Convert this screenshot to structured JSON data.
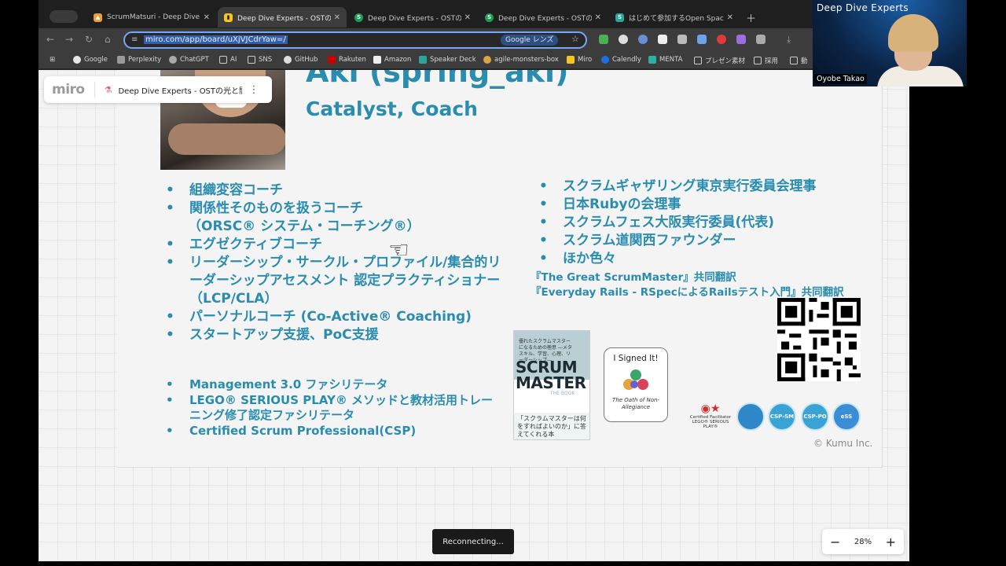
{
  "browser": {
    "tabs": [
      {
        "title": "ScrumMatsuri - Deep Dive Ex",
        "favicon_color": "#e8a040"
      },
      {
        "title": "Deep Dive Experts - OSTの光",
        "favicon_color": "#f5c61c",
        "active": true
      },
      {
        "title": "Deep Dive Experts - OSTの光",
        "favicon_color": "#1f9d55"
      },
      {
        "title": "Deep Dive Experts - OSTの光",
        "favicon_color": "#1f9d55"
      },
      {
        "title": "はじめて参加するOpen Space",
        "favicon_color": "#2aa59a"
      }
    ],
    "url": "miro.com/app/board/uXjVJCdrYaw=/",
    "lens_label": "Google レンズ",
    "bookmarks": [
      "Google",
      "Perplexity",
      "ChatGPT",
      "AI",
      "SNS",
      "GitHub",
      "Rakuten",
      "Amazon",
      "Speaker Deck",
      "agile-monsters-box",
      "Miro",
      "Calendly",
      "MENTA",
      "プレゼン素材",
      "採用",
      "動"
    ]
  },
  "miro": {
    "logo": "miro",
    "board_name": "Deep Dive Experts - OSTの光と闇 -",
    "zoom": "28%",
    "reconnect": "Reconnecting..."
  },
  "slide": {
    "name": "Aki (spring_aki)",
    "role": "Catalyst, Coach",
    "left_items": [
      "組織変容コーチ",
      "関係性そのものを扱うコーチ",
      "（ORSC® システム・コーチング®）",
      "エグゼクティブコーチ",
      "リーダーシップ・サークル・プロファイル/集合的リーダーシップアセスメント 認定プラクティショナー（LCP/CLA）",
      "パーソナルコーチ (Co-Active® Coaching)",
      "スタートアップ支援、PoC支援"
    ],
    "right_items": [
      "スクラムギャザリング東京実行委員会理事",
      "日本Rubyの会理事",
      "スクラムフェス大阪実行委員(代表)",
      "スクラム道関西ファウンダー",
      "ほか色々"
    ],
    "translations": [
      "『The Great ScrumMaster』共同翻訳",
      "『Everyday Rails - RSpecによるRailsテスト入門』共同翻訳"
    ],
    "cert_items": [
      "Management 3.0 ファシリテータ",
      "LEGO® SERIOUS PLAY® メソッドと教材活用トレーニング修了認定ファシリテータ",
      "Certified Scrum Professional(CSP)"
    ],
    "book": {
      "subtitle": "優れたスクラムマスターになるための極意 ―メタスキル、学習、心理、リーダーシップ―",
      "title1": "SCRUM",
      "title2": "MASTER",
      "title3": "THE BOOK",
      "tagline": "「スクラムマスターは何をすればよいのか」に答えてくれる本"
    },
    "signed": {
      "title": "I Signed It!",
      "subtitle": "The Oath of Non-Allegiance"
    },
    "badges": [
      "CSP-SM",
      "CSP-PO",
      "eSS"
    ],
    "facilitator": "Certified Facilitator LEGO® SERIOUS PLAY®",
    "copyright": "© Kumu Inc."
  },
  "webcam": {
    "brand": "Deep Dive Experts",
    "participant": "Oyobe Takao"
  }
}
